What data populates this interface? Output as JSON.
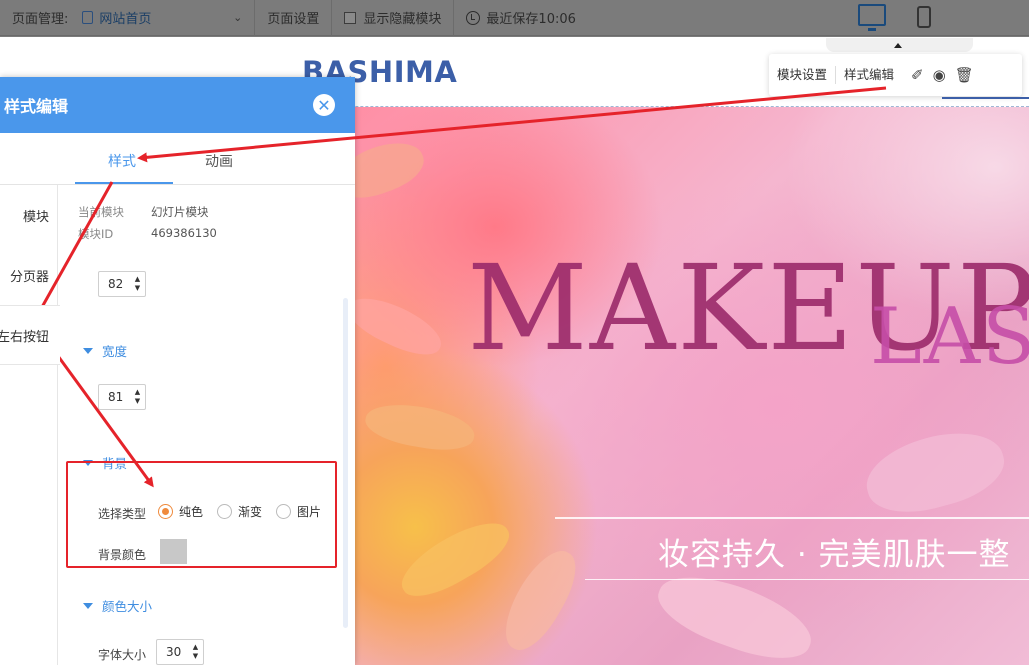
{
  "topbar": {
    "page_manage_label": "页面管理:",
    "page_select_value": "网站首页",
    "page_settings": "页面设置",
    "show_hidden": "显示隐藏模块",
    "last_saved": "最近保存10:06"
  },
  "site": {
    "logo": "BASHIMA"
  },
  "float_toolbar": {
    "module_settings": "模块设置",
    "style_edit": "样式编辑"
  },
  "banner": {
    "title": "MAKEUP",
    "title2": "LAS",
    "subtitle": "妆容持久 · 完美肌肤一整"
  },
  "panel": {
    "title": "样式编辑",
    "tab_style": "样式",
    "tab_animation": "动画",
    "side_items": [
      "模块",
      "分页器",
      "左右按钮"
    ],
    "current_module_label": "当前模块",
    "current_module_value": "幻灯片模块",
    "module_id_label": "模块ID",
    "module_id_value": "469386130",
    "height_value": "82",
    "width_title": "宽度",
    "width_value": "81",
    "bg_title": "背景",
    "bg_type_label": "选择类型",
    "bg_option_solid": "纯色",
    "bg_option_gradient": "渐变",
    "bg_option_image": "图片",
    "bg_color_label": "背景颜色",
    "bg_color": "#c8c8c8",
    "color_size_title": "颜色大小",
    "font_size_label": "字体大小",
    "font_size_value": "30"
  },
  "colors": {
    "accent": "#4a97eb",
    "annotation": "#e5232a",
    "radio_checked": "#ef8a3c"
  }
}
